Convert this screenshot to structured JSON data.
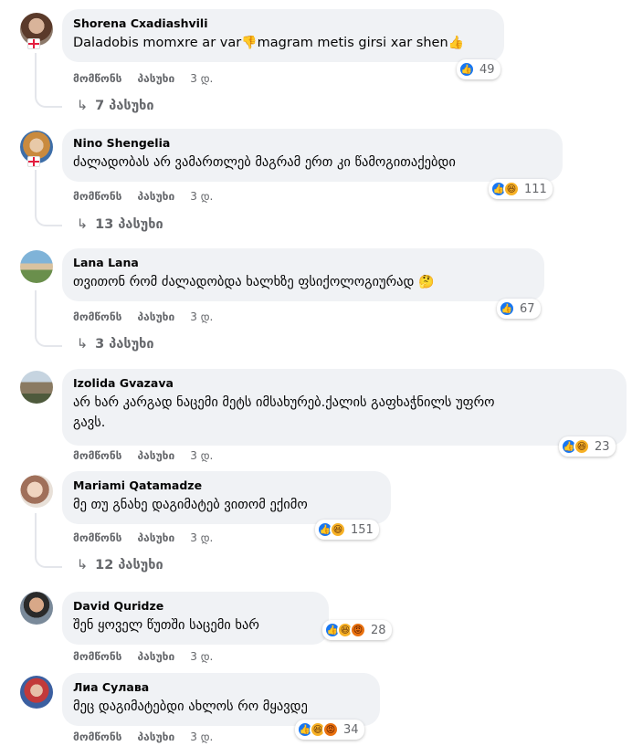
{
  "labels": {
    "like": "მომწონს",
    "reply": "პასუხი"
  },
  "comments": [
    {
      "author": "Shorena Cxadiashvili",
      "text": "Daladobis momxre ar var",
      "text2": "magram metis girsi xar shen",
      "emoji1": "👎",
      "emoji2": "👍",
      "time": "3 დ.",
      "reactions": [
        "like"
      ],
      "count": "49",
      "replies": "7 პასუხი",
      "flag": true
    },
    {
      "author": "Nino Shengelia",
      "text": "ძალადობას არ ვამართლებ მაგრამ ერთ კი წამოგითაქებდი",
      "time": "3 დ.",
      "reactions": [
        "like",
        "haha"
      ],
      "count": "111",
      "replies": "13 პასუხი",
      "flag": true
    },
    {
      "author": "Lana Lana",
      "text": "თვითონ რომ ძალადობდა ხალხზე ფსიქოლოგიურად",
      "emoji1": "🤔",
      "time": "3 დ.",
      "reactions": [
        "like"
      ],
      "count": "67",
      "replies": "3 პასუხი"
    },
    {
      "author": "Izolida Gvazava",
      "text": "არ ხარ კარგად ნაცემი მეტს იმსახურებ.ქალის გაფხაჭნილს უფრო",
      "text2": "გავს.",
      "time": "3 დ.",
      "reactions": [
        "like",
        "haha"
      ],
      "count": "23"
    },
    {
      "author": "Mariami Qatamadze",
      "text": "მე თუ გნახე დაგიმატებ ვითომ ექიმო",
      "time": "3 დ.",
      "reactions": [
        "like",
        "haha"
      ],
      "count": "151",
      "replies": "12 პასუხი"
    },
    {
      "author": "David Quridze",
      "text": "შენ ყოველ წუთში საცემი ხარ",
      "time": "3 დ.",
      "reactions": [
        "like",
        "haha",
        "angry"
      ],
      "count": "28"
    },
    {
      "author": "Лиа Сулава",
      "text": "მეც დაგიმატებდი ახლოს რო მყავდე",
      "time": "3 დ.",
      "reactions": [
        "like",
        "haha",
        "angry"
      ],
      "count": "34"
    }
  ]
}
